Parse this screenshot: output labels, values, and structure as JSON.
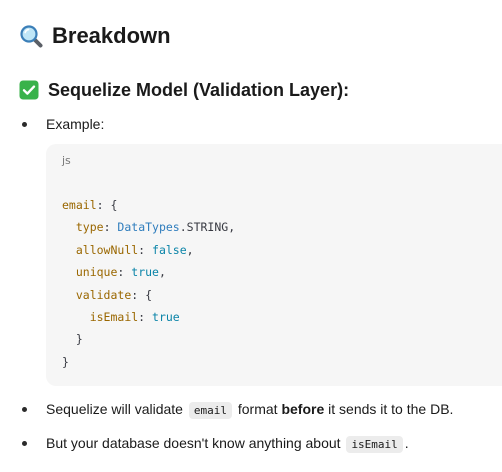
{
  "heading_main": {
    "icon": "magnifying-glass-icon",
    "text": "Breakdown"
  },
  "heading_sub": {
    "icon": "check-mark-button-icon",
    "text": "Sequelize Model (Validation Layer):"
  },
  "bullet_example": "Example:",
  "code_block": {
    "language": "js",
    "lines": {
      "l1_key": "email",
      "l1_rest": ": {",
      "l2_key": "type",
      "l2_sep": ": ",
      "l2_type": "DataTypes",
      "l2_rest": ".STRING,",
      "l3_key": "allowNull",
      "l3_sep": ": ",
      "l3_val": "false",
      "l3_rest": ",",
      "l4_key": "unique",
      "l4_sep": ": ",
      "l4_val": "true",
      "l4_rest": ",",
      "l5_key": "validate",
      "l5_rest": ": {",
      "l6_key": "isEmail",
      "l6_sep": ": ",
      "l6_val": "true",
      "l7": "}",
      "l8": "}"
    }
  },
  "bullet_validate": {
    "pre": "Sequelize will validate ",
    "code": "email",
    "mid": " format ",
    "bold": "before",
    "post": " it sends it to the DB."
  },
  "bullet_db": {
    "pre": "But your database doesn't know anything about ",
    "code": "isEmail",
    "post": "."
  },
  "colors": {
    "code_key": "#9a6700",
    "code_type": "#2f7dbd",
    "code_bool": "#0a84a8",
    "code_bg": "#f6f6f6",
    "check_green": "#38b24a"
  }
}
